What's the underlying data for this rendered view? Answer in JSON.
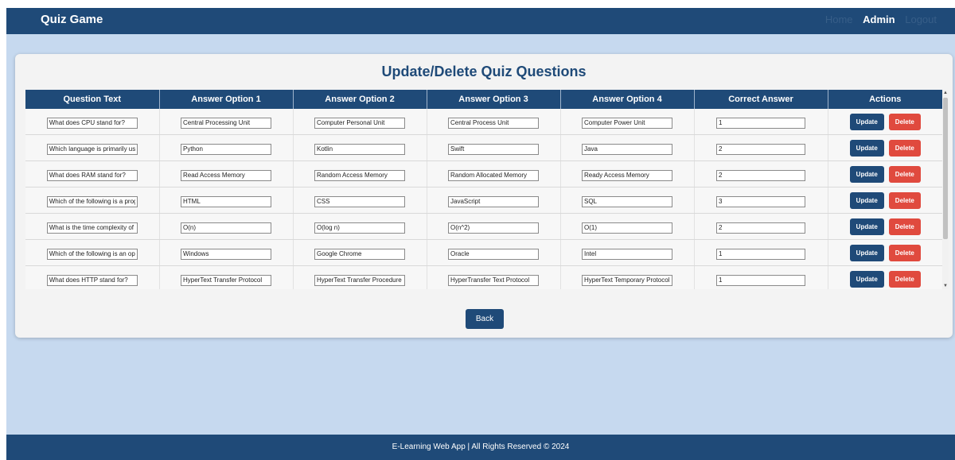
{
  "nav": {
    "brand": "Quiz Game",
    "links": [
      {
        "label": "Home"
      },
      {
        "label": "Admin"
      },
      {
        "label": "Logout"
      }
    ]
  },
  "page": {
    "title": "Update/Delete Quiz Questions",
    "back_label": "Back"
  },
  "table": {
    "headers": [
      "Question Text",
      "Answer Option 1",
      "Answer Option 2",
      "Answer Option 3",
      "Answer Option 4",
      "Correct Answer",
      "Actions"
    ],
    "update_label": "Update",
    "delete_label": "Delete",
    "rows": [
      {
        "question": "What does CPU stand for?",
        "opt1": "Central Processing Unit",
        "opt2": "Computer Personal Unit",
        "opt3": "Central Process Unit",
        "opt4": "Computer Power Unit",
        "correct": "1"
      },
      {
        "question": "Which language is primarily used for Android development?",
        "opt1": "Python",
        "opt2": "Kotlin",
        "opt3": "Swift",
        "opt4": "Java",
        "correct": "2"
      },
      {
        "question": "What does RAM stand for?",
        "opt1": "Read Access Memory",
        "opt2": "Random Access Memory",
        "opt3": "Random Allocated Memory",
        "opt4": "Ready Access Memory",
        "correct": "2"
      },
      {
        "question": "Which of the following is a programming language?",
        "opt1": "HTML",
        "opt2": "CSS",
        "opt3": "JavaScript",
        "opt4": "SQL",
        "correct": "3"
      },
      {
        "question": "What is the time complexity of binary search?",
        "opt1": "O(n)",
        "opt2": "O(log n)",
        "opt3": "O(n^2)",
        "opt4": "O(1)",
        "correct": "2"
      },
      {
        "question": "Which of the following is an operating system?",
        "opt1": "Windows",
        "opt2": "Google Chrome",
        "opt3": "Oracle",
        "opt4": "Intel",
        "correct": "1"
      },
      {
        "question": "What does HTTP stand for?",
        "opt1": "HyperText Transfer Protocol",
        "opt2": "HyperText Transfer Procedure",
        "opt3": "HyperTransfer Text Protocol",
        "opt4": "HyperText Temporary Protocol",
        "correct": "1"
      }
    ]
  },
  "footer": {
    "text": "E-Learning Web App | All Rights Reserved © 2024"
  },
  "colors": {
    "primary": "#1f4a78",
    "page_bg": "#c6d9ef",
    "delete": "#e04a3e"
  },
  "icons": {
    "scroll_up": "scroll-up-arrow-icon",
    "scroll_down": "scroll-down-arrow-icon"
  }
}
